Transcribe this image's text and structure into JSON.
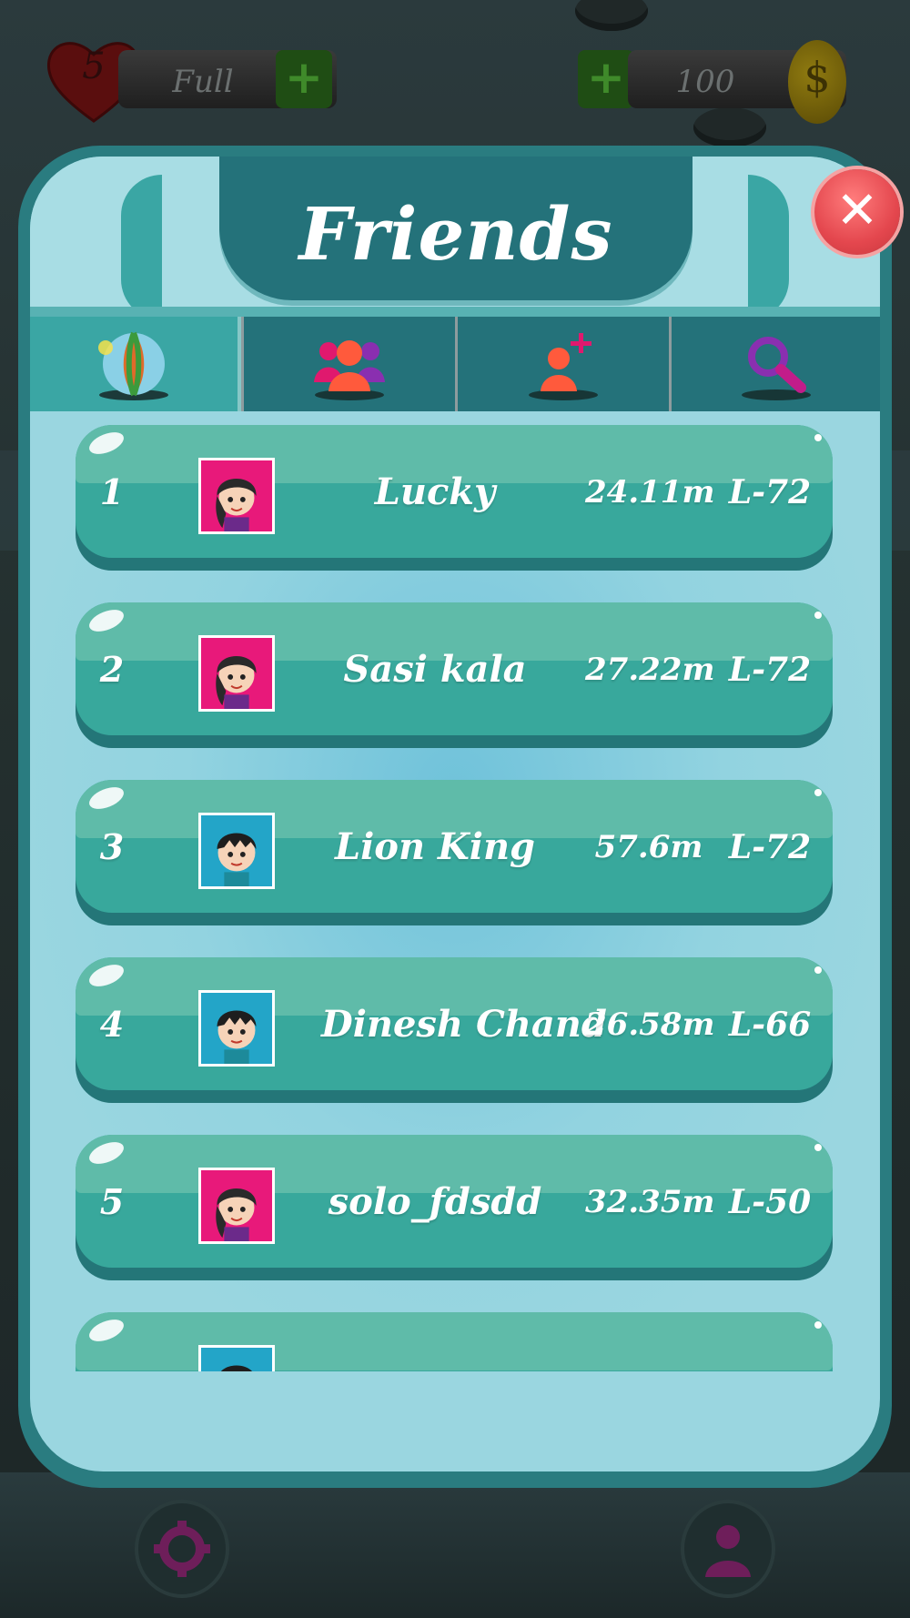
{
  "hud": {
    "lives": "5",
    "lives_status": "Full",
    "coins": "100",
    "plus": "+"
  },
  "panel": {
    "title": "Friends",
    "close_label": "✕"
  },
  "tabs": [
    {
      "name": "tab-world",
      "icon": "globe-icon",
      "active": true
    },
    {
      "name": "tab-friends",
      "icon": "friends-group-icon",
      "active": false
    },
    {
      "name": "tab-add-friend",
      "icon": "add-friend-icon",
      "active": false
    },
    {
      "name": "tab-search",
      "icon": "search-icon",
      "active": false
    }
  ],
  "friends": [
    {
      "rank": "1",
      "name": "Lucky",
      "distance": "24.11m",
      "level": "L-72",
      "avatar": "girl-avatar"
    },
    {
      "rank": "2",
      "name": "Sasi kala",
      "distance": "27.22m",
      "level": "L-72",
      "avatar": "girl-avatar"
    },
    {
      "rank": "3",
      "name": "Lion King",
      "distance": "57.6m",
      "level": "L-72",
      "avatar": "boy-avatar"
    },
    {
      "rank": "4",
      "name": "Dinesh Chand",
      "distance": "26.58m",
      "level": "L-66",
      "avatar": "boy-avatar"
    },
    {
      "rank": "5",
      "name": "solo_fdsdd",
      "distance": "32.35m",
      "level": "L-50",
      "avatar": "girl-avatar"
    },
    {
      "rank": "",
      "name": "",
      "distance": "",
      "level": "",
      "avatar": "boy-avatar"
    }
  ],
  "bottom": {
    "settings_icon": "gear-icon",
    "profile_icon": "person-icon"
  },
  "colors": {
    "panel": "#9ad6e0",
    "banner": "#24727a",
    "row": "#38a89c",
    "close": "#e4474e"
  }
}
